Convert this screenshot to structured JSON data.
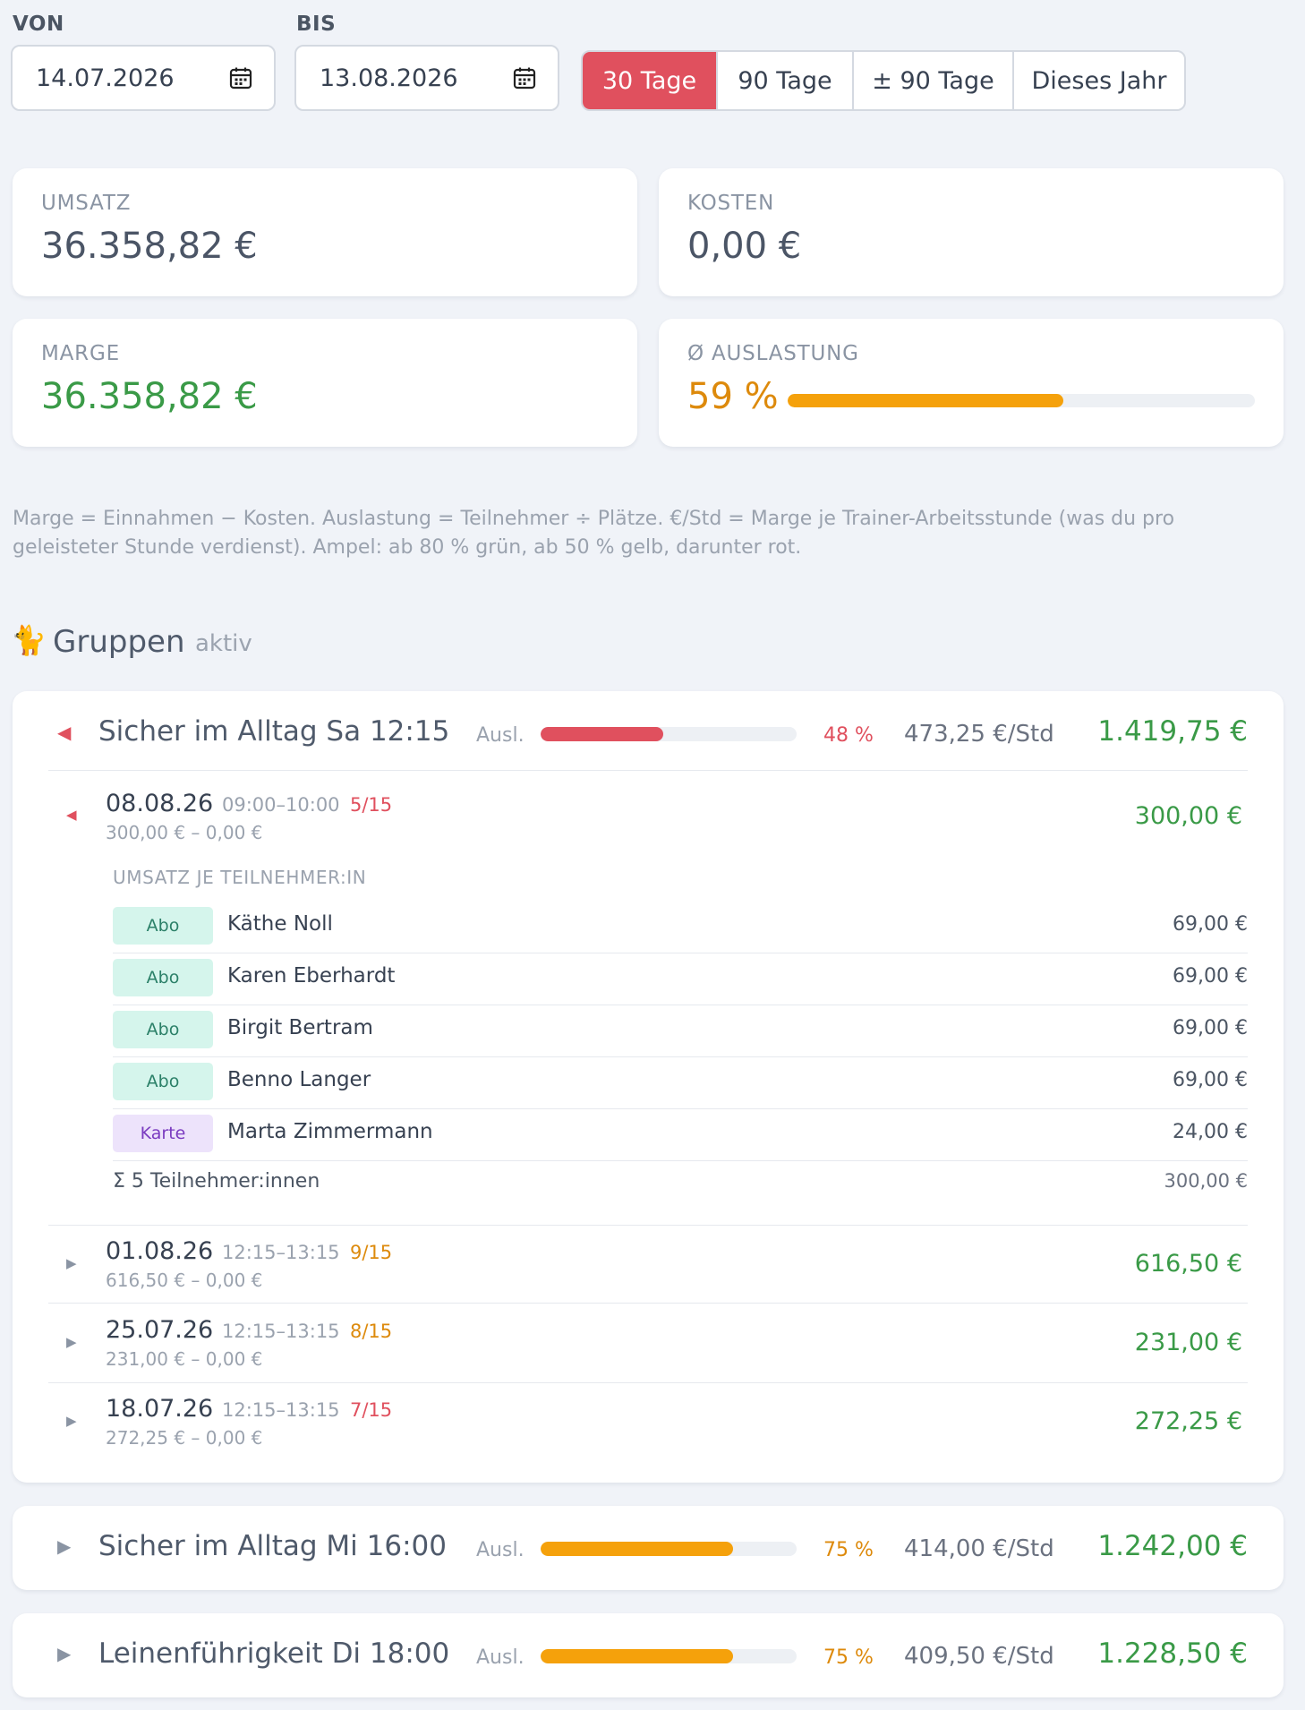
{
  "filter": {
    "from_label": "VON",
    "from_value": "14.07.2026",
    "to_label": "BIS",
    "to_value": "13.08.2026",
    "ranges": [
      "30 Tage",
      "90 Tage",
      "± 90 Tage",
      "Dieses Jahr"
    ],
    "active_range": "30 Tage"
  },
  "kpis": {
    "umsatz": {
      "label": "UMSATZ",
      "value": "36.358,82 €"
    },
    "kosten": {
      "label": "KOSTEN",
      "value": "0,00 €"
    },
    "marge": {
      "label": "MARGE",
      "value": "36.358,82 €"
    },
    "auslastung": {
      "label": "Ø AUSLASTUNG",
      "value": "59 %",
      "level": 0.59
    }
  },
  "note": "Marge = Einnahmen − Kosten. Auslastung = Teilnehmer ÷ Plätze. €/Std = Marge je Trainer-Arbeitsstunde (was du pro geleisteter Stunde verdienst). Ampel: ab 80 % grün, ab 50 % gelb, darunter rot.",
  "section": {
    "icon": "🐈",
    "title": "Gruppen",
    "subtitle": "aktiv"
  },
  "ausl_label": "Ausl.",
  "groups": [
    {
      "title": "Sicher im Alltag Sa 12:15",
      "pct": "48 %",
      "level": 0.48,
      "per_hour": "473,25 €/Std",
      "total": "1.419,75 €",
      "sessions": [
        {
          "date": "08.08.26",
          "time": "09:00–10:00",
          "occupancy": "5/15",
          "revenue": "300,00 €",
          "cost": "0,00 €",
          "total": "300,00 €",
          "breakdown_title": "UMSATZ JE TEILNEHMER:IN",
          "participants": [
            {
              "type": "Abo",
              "name": "Käthe Noll",
              "amount": "69,00 €"
            },
            {
              "type": "Abo",
              "name": "Karen Eberhardt",
              "amount": "69,00 €"
            },
            {
              "type": "Abo",
              "name": "Birgit Bertram",
              "amount": "69,00 €"
            },
            {
              "type": "Abo",
              "name": "Benno Langer",
              "amount": "69,00 €"
            },
            {
              "type": "Karte",
              "name": "Marta Zimmermann",
              "amount": "24,00 €"
            }
          ],
          "sum_label": "Σ 5 Teilnehmer:innen",
          "sum_amount": "300,00 €"
        },
        {
          "date": "01.08.26",
          "time": "12:15–13:15",
          "occupancy": "9/15",
          "revenue": "616,50 €",
          "cost": "0,00 €",
          "total": "616,50 €"
        },
        {
          "date": "25.07.26",
          "time": "12:15–13:15",
          "occupancy": "8/15",
          "revenue": "231,00 €",
          "cost": "0,00 €",
          "total": "231,00 €"
        },
        {
          "date": "18.07.26",
          "time": "12:15–13:15",
          "occupancy": "7/15",
          "revenue": "272,25 €",
          "cost": "0,00 €",
          "total": "272,25 €"
        }
      ]
    },
    {
      "title": "Sicher im Alltag Mi 16:00",
      "pct": "75 %",
      "level": 0.75,
      "per_hour": "414,00 €/Std",
      "total": "1.242,00 €"
    },
    {
      "title": "Leinenführigkeit Di 18:00",
      "pct": "75 %",
      "level": 0.75,
      "per_hour": "409,50 €/Std",
      "total": "1.228,50 €"
    }
  ],
  "colors": {
    "accent": "#e0505e",
    "green": "#3a9a47",
    "orange": "#dd8a0c",
    "bar_orange": "#f5a10b",
    "bar_red": "#e0505e",
    "background": "#f0f3f8"
  }
}
